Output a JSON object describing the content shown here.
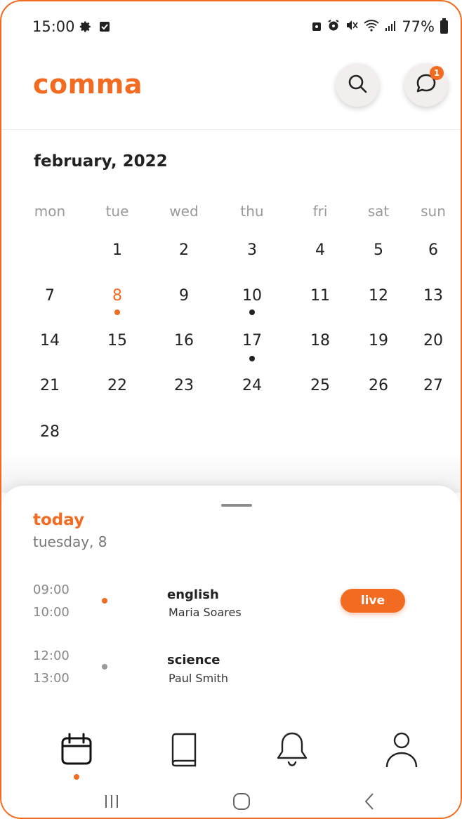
{
  "status_bar": {
    "time": "15:00",
    "battery": "77%",
    "icons": [
      "settings-icon",
      "checkbox-icon",
      "lock-icon",
      "alarm-icon",
      "mute-icon",
      "wifi-icon",
      "signal-icon",
      "battery-icon"
    ]
  },
  "header": {
    "logo": "comma",
    "search_icon": "search-icon",
    "messages_icon": "chat-icon",
    "messages_badge": "1"
  },
  "calendar": {
    "month_title": "february, 2022",
    "weekdays": [
      "mon",
      "tue",
      "wed",
      "thu",
      "fri",
      "sat",
      "sun"
    ],
    "days": {
      "d1": "1",
      "d2": "2",
      "d3": "3",
      "d4": "4",
      "d5": "5",
      "d6": "6",
      "d7": "7",
      "d8": "8",
      "d9": "9",
      "d10": "10",
      "d11": "11",
      "d12": "12",
      "d13": "13",
      "d14": "14",
      "d15": "15",
      "d16": "16",
      "d17": "17",
      "d18": "18",
      "d19": "19",
      "d20": "20",
      "d21": "21",
      "d22": "22",
      "d23": "23",
      "d24": "24",
      "d25": "25",
      "d26": "26",
      "d27": "27",
      "d28": "28"
    },
    "selected_day": "8",
    "days_with_events": [
      "8",
      "10",
      "17"
    ]
  },
  "today": {
    "label": "today",
    "date": "tuesday, 8",
    "classes": [
      {
        "start": "09:00",
        "end": "10:00",
        "subject": "english",
        "teacher": "Maria Soares",
        "status": "live",
        "dot_color": "#f26b21"
      },
      {
        "start": "12:00",
        "end": "13:00",
        "subject": "science",
        "teacher": "Paul Smith",
        "dot_color": "#9a9a9a"
      }
    ]
  },
  "bottom_nav": {
    "items": [
      "calendar-icon",
      "book-icon",
      "bell-icon",
      "profile-icon"
    ],
    "active": "calendar-icon"
  },
  "colors": {
    "accent": "#f26b21",
    "text": "#222222",
    "muted": "#9a9a9a"
  }
}
